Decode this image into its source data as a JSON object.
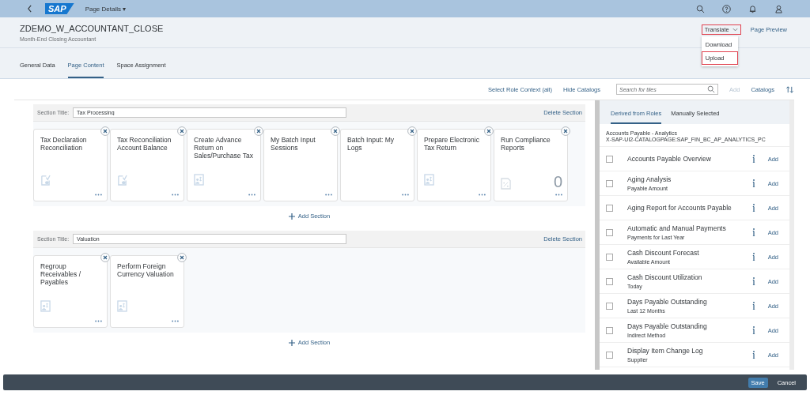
{
  "shell": {
    "logo": "SAP",
    "title": "Page Details ▾"
  },
  "header": {
    "title": "ZDEMO_W_ACCOUNTANT_CLOSE",
    "subtitle": "Month-End Closing Accountant",
    "actions": [
      {
        "label": "Translate",
        "highlighted": true,
        "kind": "menu"
      },
      {
        "label": "Page Preview",
        "highlighted": false,
        "kind": "link"
      }
    ],
    "menu": [
      {
        "label": "Download",
        "highlighted": false
      },
      {
        "label": "Upload",
        "highlighted": true
      }
    ]
  },
  "tabs": [
    {
      "label": "General Data",
      "selected": false
    },
    {
      "label": "Page Content",
      "selected": true
    },
    {
      "label": "Space Assignment",
      "selected": false
    }
  ],
  "toolbar": {
    "links": [
      "Select Role Context (all)",
      "Hide Catalogs"
    ],
    "search": {
      "placeholder": "Search for tiles"
    },
    "add": {
      "label": "Add",
      "disabled": true
    },
    "catalogs": "Catalogs"
  },
  "sections": [
    {
      "label": "Section Title:",
      "value": "Tax Processing",
      "delete": "Delete Section",
      "tiles": [
        {
          "title": "Tax Declaration Reconciliation",
          "kind": "check"
        },
        {
          "title": "Tax Reconciliation Account Balance",
          "kind": "check"
        },
        {
          "title": "Create Advance Return on Sales/Purchase Tax",
          "kind": "card"
        },
        {
          "title": "My Batch Input Sessions",
          "kind": "plain"
        },
        {
          "title": "Batch Input: My Logs",
          "kind": "plain"
        },
        {
          "title": "Prepare Electronic Tax Return",
          "kind": "card"
        },
        {
          "title": "Run Compliance Reports",
          "kind": "numeric",
          "number": "0"
        }
      ]
    },
    {
      "label": "Section Title:",
      "value": "Valuation",
      "delete": "Delete Section",
      "tiles": [
        {
          "title": "Regroup Receivables / Payables",
          "kind": "card"
        },
        {
          "title": "Perform Foreign Currency Valuation",
          "kind": "card"
        }
      ]
    }
  ],
  "add_section": [
    "Add Section",
    "Add Section"
  ],
  "catalog": {
    "tabs": [
      {
        "label": "Derived from Roles",
        "selected": true
      },
      {
        "label": "Manually Selected",
        "selected": false
      }
    ],
    "name": "Accounts Payable - Analytics",
    "id": "X-SAP-UI2-CATALOGPAGE:SAP_FIN_BC_AP_ANALYTICS_PC",
    "rows": [
      {
        "title": "Accounts Payable Overview",
        "checked": false,
        "add": "Add"
      },
      {
        "title": "Aging Analysis",
        "subtitle": "Payable Amount",
        "checked": false,
        "add": "Add"
      },
      {
        "title": "Aging Report for Accounts Payable",
        "checked": false,
        "add": "Add"
      },
      {
        "title": "Automatic and Manual Payments",
        "subtitle": "Payments for Last Year",
        "checked": false,
        "add": "Add"
      },
      {
        "title": "Cash Discount Forecast",
        "subtitle": "Available Amount",
        "checked": false,
        "add": "Add"
      },
      {
        "title": "Cash Discount Utilization",
        "subtitle": "Today",
        "checked": false,
        "add": "Add"
      },
      {
        "title": "Days Payable Outstanding",
        "subtitle": "Last 12 Months",
        "checked": false,
        "add": "Add"
      },
      {
        "title": "Days Payable Outstanding",
        "subtitle": "Indirect Method",
        "checked": false,
        "add": "Add"
      },
      {
        "title": "Display Item Change Log",
        "subtitle": "Supplier",
        "checked": false,
        "add": "Add"
      }
    ]
  },
  "footer": [
    {
      "label": "Save",
      "kind": "emphasized"
    },
    {
      "label": "Cancel",
      "kind": "plain"
    }
  ]
}
